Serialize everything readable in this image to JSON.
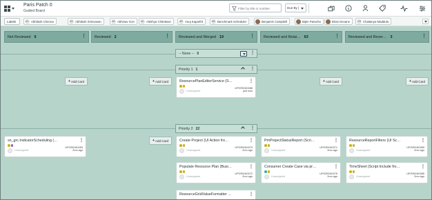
{
  "header": {
    "title": "Paris Patch 0",
    "subtitle": "Guided Board",
    "filter_placeholder": "Filter by title or number",
    "due_select_value": "Due By |"
  },
  "labels_bar": {
    "labels_button": "Labels",
    "members": [
      {
        "initials": "AC",
        "name": "Abhilash Chenna"
      },
      {
        "initials": "AS",
        "name": "Abhilash Srinivasan"
      },
      {
        "initials": "AG",
        "name": "Abhinav OJA"
      },
      {
        "initials": "AC",
        "name": "Alekhya Chitrakavi"
      },
      {
        "initials": "AR",
        "name": "Anuj Kapartht"
      },
      {
        "initials": "BS",
        "name": "Benchmark Scheduler"
      },
      {
        "initials": "",
        "name": "Benjamin Campbell"
      },
      {
        "initials": "",
        "name": "Bipin Paracha"
      },
      {
        "initials": "",
        "name": "Brian Devane"
      },
      {
        "initials": "CM",
        "name": "Chaitanya Maddula"
      }
    ]
  },
  "columns": [
    {
      "name": "Not Reviewed",
      "count": "6"
    },
    {
      "name": "Reviewed",
      "count": "2"
    },
    {
      "name": "Reviewed and Merged",
      "count": "19"
    },
    {
      "name": "Reviewed and Retai…",
      "count": "63"
    },
    {
      "name": "Reviewed and Rever…",
      "count": "3"
    }
  ],
  "lanes": {
    "none": {
      "label": "-- None --",
      "count": "0"
    },
    "p1": {
      "label": "Priority 1",
      "count": "1"
    },
    "p2": {
      "label": "Priority 2",
      "count": "22"
    }
  },
  "add_card_label": "Add Card",
  "unassigned_label": "Unassigned",
  "cards": [
    {
      "title": "ResourcePlanEditorService (S…",
      "number": "UPGR0040088",
      "time": "just now",
      "tags": [
        "#c9b21b",
        "#c9b21b"
      ]
    },
    {
      "title": "sn_grc.IndicatorScheduling (…",
      "number": "UPGR0040053",
      "time": "2mo ago",
      "tags": [
        "#c9b21b",
        "#8a63b8"
      ]
    },
    {
      "title": "Create Project (UI Action fro…",
      "number": "UPGR0040075",
      "time": "2mo ago",
      "tags": [
        "#c9b21b",
        "#c9b21b"
      ]
    },
    {
      "title": "PmProjectStatusReport (Scri…",
      "number": "UPGR0040071",
      "time": "2mo ago",
      "tags": [
        "#c9b21b",
        "#c9b21b"
      ]
    },
    {
      "title": "ResourceReportFilters (UI Sc…",
      "number": "UPGR0040089",
      "time": "2mo ago",
      "tags": [
        "#c9b21b",
        "#c9b21b"
      ]
    },
    {
      "title": "Populate Resource Plan (Busi…",
      "number": "UPGR0040072",
      "time": "2mo ago",
      "tags": [
        "#c9b21b",
        "#c9b21b"
      ]
    },
    {
      "title": "Consumer Create Case via pr…",
      "number": "UPGR0040076",
      "time": "2mo ago",
      "tags": [
        "#3bb3a6",
        "#c9b21b"
      ]
    },
    {
      "title": "TimeSheet (Script Include fro…",
      "number": "UPGR0040085",
      "time": "2mo ago",
      "tags": [
        "#c9b21b",
        "#c9b21b"
      ]
    },
    {
      "title": "ResourceGridValueFormatter …",
      "number": "",
      "time": "",
      "tags": []
    }
  ]
}
